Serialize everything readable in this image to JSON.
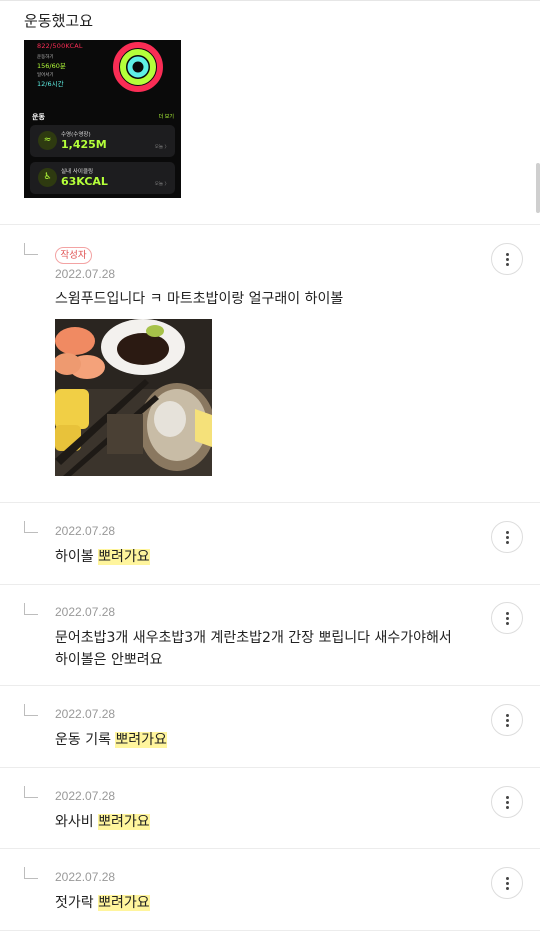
{
  "comments": {
    "first": {
      "text": "운동했고요",
      "activity": {
        "move": "822/500KCAL",
        "exercise_label": "운동하기",
        "exercise_value": "156/60분",
        "stand_label": "일어서기",
        "stand_value": "12/6시간",
        "section_title": "운동",
        "see_all": "더 보기",
        "workouts": [
          {
            "title": "수영(수영장)",
            "value": "1,425M",
            "day": "오늘 〉"
          },
          {
            "title": "실내 사이클링",
            "value": "63KCAL",
            "day": "오늘 〉"
          }
        ]
      }
    },
    "replies": [
      {
        "author_badge": "작성자",
        "date": "2022.07.28",
        "text": "스윔푸드입니다 ㅋ 마트초밥이랑 얼구래이 하이볼",
        "has_photo": true
      },
      {
        "date": "2022.07.28",
        "text_plain": "하이볼 ",
        "text_highlight": "뽀려가요"
      },
      {
        "date": "2022.07.28",
        "text_line1": "문어초밥3개 새우초밥3개 계란초밥2개 간장 뽀립니다 새수가야해서",
        "text_line2": "하이볼은 안뽀려요"
      },
      {
        "date": "2022.07.28",
        "text_plain": "운동 기록 ",
        "text_highlight": "뽀려가요"
      },
      {
        "date": "2022.07.28",
        "text_plain": "와사비 ",
        "text_highlight": "뽀려가요"
      },
      {
        "date": "2022.07.28",
        "text_plain": "젓가락 ",
        "text_highlight": "뽀려가요"
      }
    ]
  },
  "icons": {
    "reply_indicator": "reply-arrow-icon",
    "more_menu": "more-vertical-icon"
  },
  "colors": {
    "highlight": "#fff59d",
    "author_badge": "#e05252",
    "date_text": "#999999",
    "move_ring": "#fa2d55",
    "exercise_ring": "#b4ff3a",
    "stand_ring": "#5ff0e6"
  }
}
